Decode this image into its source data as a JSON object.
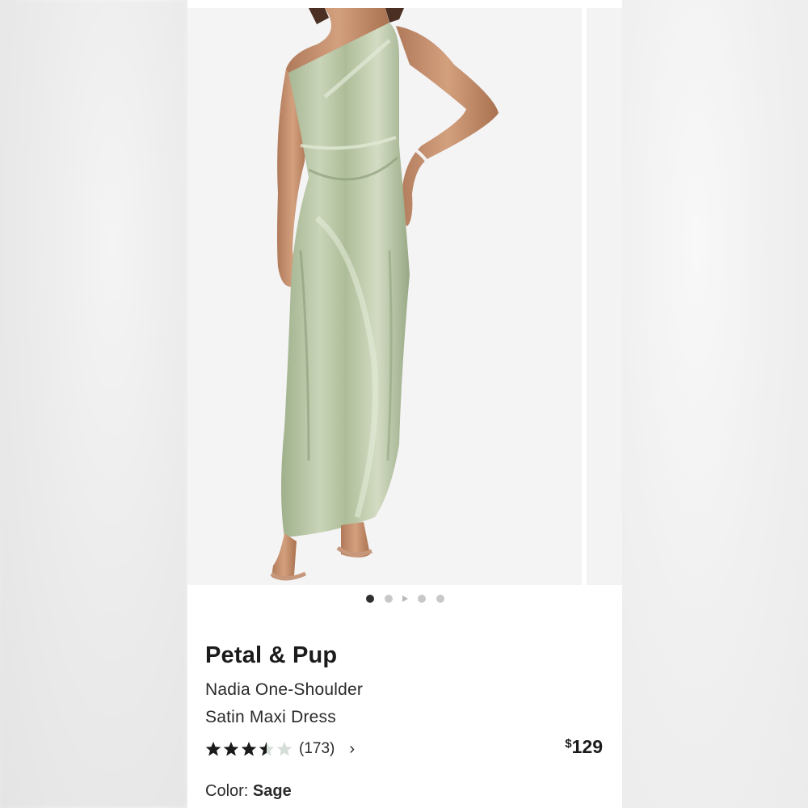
{
  "product": {
    "brand": "Petal & Pup",
    "title_line1": "Nadia One-Shoulder",
    "title_line2": "Satin Maxi Dress",
    "rating": 3.5,
    "rating_max": 5,
    "review_count": "(173)",
    "price_currency": "$",
    "price_amount": "129",
    "color_label": "Color:",
    "color_value": "Sage"
  },
  "carousel": {
    "slide_count": 5,
    "active_index": 0,
    "video_slide_index": 2,
    "image_subject": "woman in sage green one-shoulder satin maxi dress"
  },
  "icons": {
    "chevron": "chevron-right-icon",
    "star": "star-icon"
  },
  "colors": {
    "dress_sage": "#b7c4a4",
    "star_filled": "#1b1b1b",
    "star_empty": "#d4ddd6",
    "dot_active": "#2e2e2e",
    "dot_inactive": "#c8c8c8"
  }
}
